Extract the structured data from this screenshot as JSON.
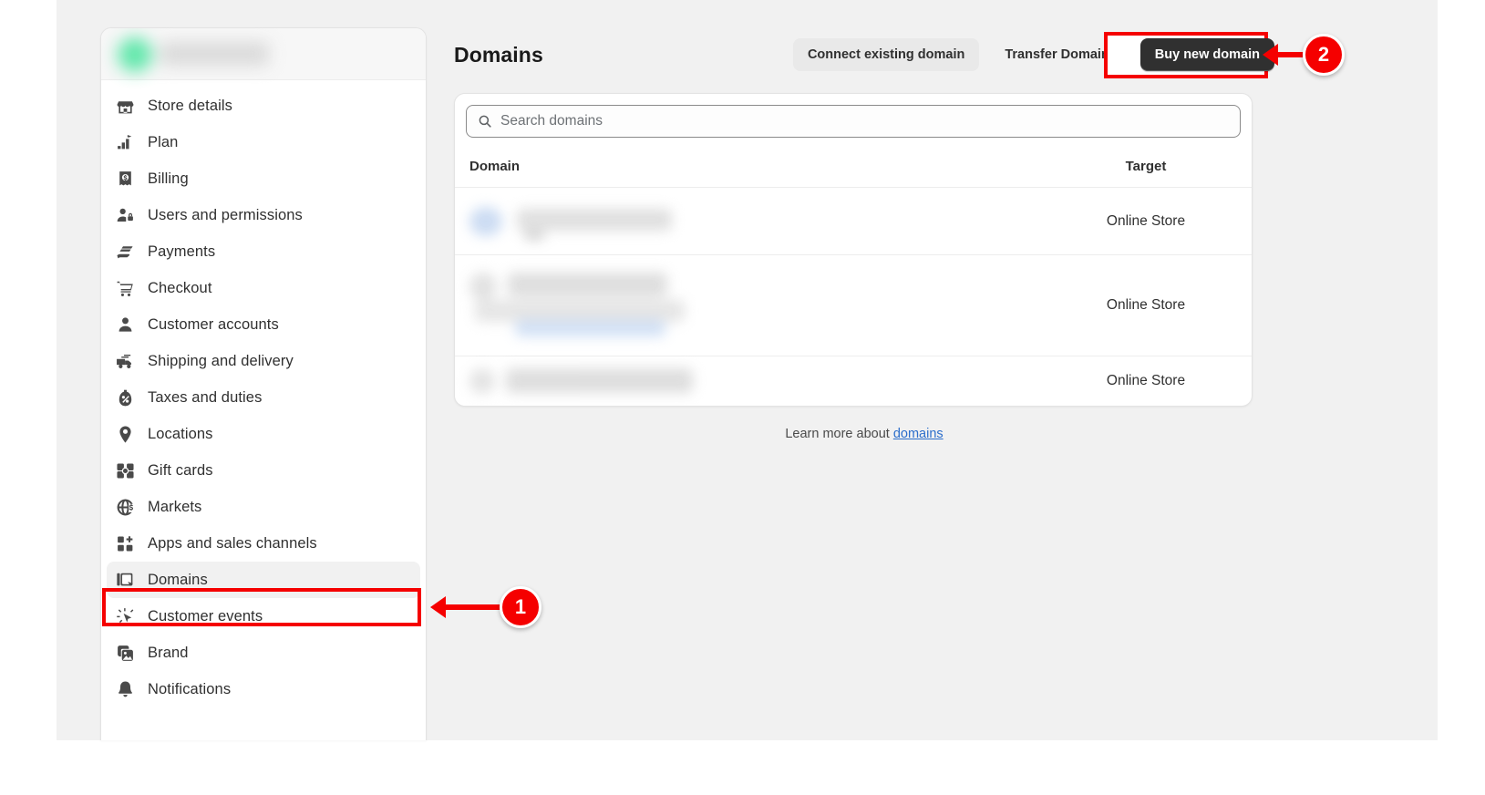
{
  "sidebar": {
    "store_logo": "store-logo-redacted",
    "items": [
      {
        "label": "Store details",
        "icon": "storefront-icon",
        "active": false
      },
      {
        "label": "Plan",
        "icon": "plan-chart-icon",
        "active": false
      },
      {
        "label": "Billing",
        "icon": "billing-receipt-icon",
        "active": false
      },
      {
        "label": "Users and permissions",
        "icon": "users-permissions-icon",
        "active": false
      },
      {
        "label": "Payments",
        "icon": "payments-hand-icon",
        "active": false
      },
      {
        "label": "Checkout",
        "icon": "checkout-cart-icon",
        "active": false
      },
      {
        "label": "Customer accounts",
        "icon": "customer-accounts-icon",
        "active": false
      },
      {
        "label": "Shipping and delivery",
        "icon": "shipping-truck-icon",
        "active": false
      },
      {
        "label": "Taxes and duties",
        "icon": "taxes-duties-icon",
        "active": false
      },
      {
        "label": "Locations",
        "icon": "location-pin-icon",
        "active": false
      },
      {
        "label": "Gift cards",
        "icon": "gift-card-icon",
        "active": false
      },
      {
        "label": "Markets",
        "icon": "markets-globe-icon",
        "active": false
      },
      {
        "label": "Apps and sales channels",
        "icon": "apps-channels-icon",
        "active": false
      },
      {
        "label": "Domains",
        "icon": "domains-icon",
        "active": true
      },
      {
        "label": "Customer events",
        "icon": "customer-events-icon",
        "active": false
      },
      {
        "label": "Brand",
        "icon": "brand-image-icon",
        "active": false
      },
      {
        "label": "Notifications",
        "icon": "notifications-bell-icon",
        "active": false
      }
    ]
  },
  "header": {
    "title": "Domains",
    "buttons": {
      "connect": "Connect existing domain",
      "transfer": "Transfer Domain",
      "buy": "Buy new domain"
    }
  },
  "search": {
    "placeholder": "Search domains",
    "value": "",
    "icon": "search-icon"
  },
  "table": {
    "columns": {
      "domain": "Domain",
      "target": "Target"
    },
    "rows": [
      {
        "domain": "redacted-domain-1",
        "target": "Online Store",
        "lines": 1
      },
      {
        "domain": "redacted-domain-2",
        "target": "Online Store",
        "lines": 2
      },
      {
        "domain": "redacted-domain-3",
        "target": "Online Store",
        "lines": 1
      }
    ]
  },
  "footer": {
    "learn_prefix": "Learn more about ",
    "learn_link": "domains"
  },
  "annotations": [
    {
      "number": "1",
      "target": "sidebar-item-domains"
    },
    {
      "number": "2",
      "target": "buy-new-domain-button"
    }
  ],
  "colors": {
    "annotation_red": "#f50000",
    "primary_button": "#303030",
    "link_blue": "#2c6ecb",
    "page_background": "#f1f1f1"
  }
}
